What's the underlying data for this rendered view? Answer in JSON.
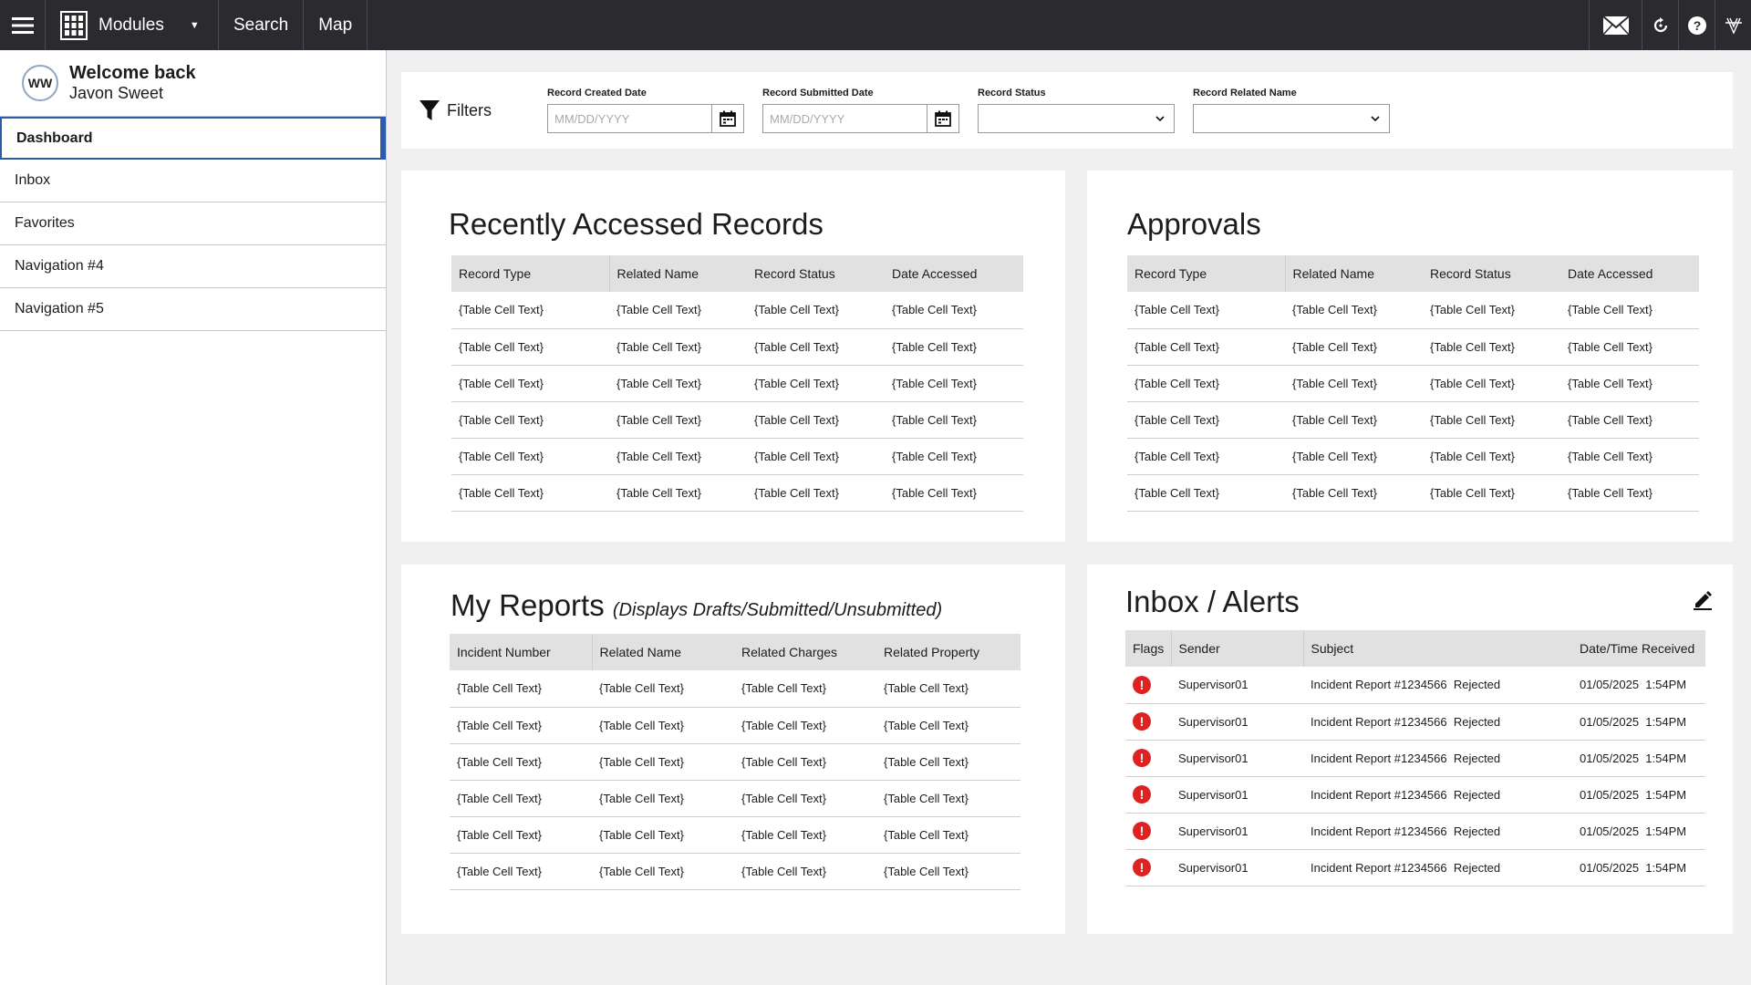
{
  "topbar": {
    "modules_label": "Modules",
    "links": [
      "Search",
      "Map"
    ],
    "icons": [
      "menu-icon",
      "app-grid-icon",
      "mail-icon",
      "refresh-icon",
      "help-icon",
      "app-logo-icon"
    ]
  },
  "sidebar": {
    "avatar_initials": "WW",
    "welcome_line1": "Welcome back",
    "welcome_line2": "Javon Sweet",
    "items": [
      {
        "label": "Dashboard",
        "active": true
      },
      {
        "label": "Inbox"
      },
      {
        "label": "Favorites"
      },
      {
        "label": "Navigation #4"
      },
      {
        "label": "Navigation #5"
      }
    ]
  },
  "filters": {
    "title": "Filters",
    "created_label": "Record Created Date",
    "created_placeholder": "MM/DD/YYYY",
    "submitted_label": "Record Submitted Date",
    "submitted_placeholder": "MM/DD/YYYY",
    "status_label": "Record Status",
    "related_label": "Record Related Name"
  },
  "recent": {
    "title": "Recently Accessed Records",
    "headers": [
      "Record Type",
      "Related Name",
      "Record Status",
      "Date Accessed"
    ],
    "cell": "{Table Cell Text}"
  },
  "approvals": {
    "title": "Approvals",
    "headers": [
      "Record Type",
      "Related Name",
      "Record Status",
      "Date Accessed"
    ],
    "cell": "{Table Cell Text}"
  },
  "reports": {
    "title": "My Reports",
    "subtitle": "(Displays Drafts/Submitted/Unsubmitted)",
    "headers": [
      "Incident Number",
      "Related Name",
      "Related Charges",
      "Related Property"
    ],
    "cell": "{Table Cell Text}"
  },
  "inbox": {
    "title": "Inbox / Alerts",
    "headers": [
      "Flags",
      "Sender",
      "Subject",
      "Date/Time Received"
    ],
    "rows": [
      {
        "flag": "!",
        "sender": "Supervisor01",
        "subject": "Incident Report #1234566  Rejected",
        "received": "01/05/2025  1:54PM"
      },
      {
        "flag": "!",
        "sender": "Supervisor01",
        "subject": "Incident Report #1234566  Rejected",
        "received": "01/05/2025  1:54PM"
      },
      {
        "flag": "!",
        "sender": "Supervisor01",
        "subject": "Incident Report #1234566  Rejected",
        "received": "01/05/2025  1:54PM"
      },
      {
        "flag": "!",
        "sender": "Supervisor01",
        "subject": "Incident Report #1234566  Rejected",
        "received": "01/05/2025  1:54PM"
      },
      {
        "flag": "!",
        "sender": "Supervisor01",
        "subject": "Incident Report #1234566  Rejected",
        "received": "01/05/2025  1:54PM"
      },
      {
        "flag": "!",
        "sender": "Supervisor01",
        "subject": "Incident Report #1234566  Rejected",
        "received": "01/05/2025  1:54PM"
      }
    ]
  },
  "colors": {
    "topbar": "#2b2b2f",
    "accent": "#2f5aa8",
    "alert": "#dd2222",
    "table_header": "#e1e1e1",
    "background": "#f0f0f0"
  }
}
